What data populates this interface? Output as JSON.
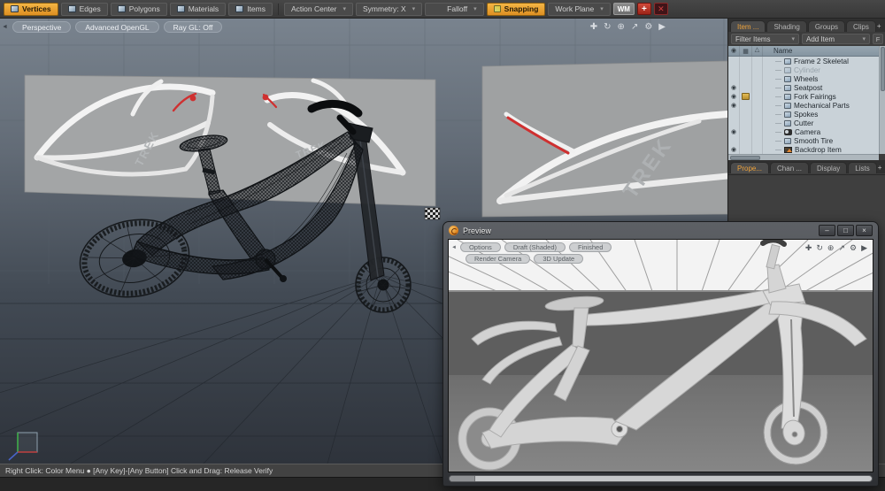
{
  "toolbar": {
    "modes": [
      {
        "label": "Vertices"
      },
      {
        "label": "Edges"
      },
      {
        "label": "Polygons"
      },
      {
        "label": "Materials"
      },
      {
        "label": "Items"
      }
    ],
    "action_center": "Action Center",
    "symmetry": "Symmetry: X",
    "falloff": "Falloff",
    "snapping": "Snapping",
    "work_plane": "Work Plane",
    "wm": "WM",
    "add": "+"
  },
  "viewport": {
    "buttons": [
      "Perspective",
      "Advanced OpenGL",
      "Ray GL: Off"
    ]
  },
  "panel": {
    "tabs_upper": [
      "Item ...",
      "Shading",
      "Groups",
      "Clips"
    ],
    "filter": "Filter Items",
    "add_item": "Add Item",
    "f": "F",
    "name_col": "Name",
    "items": [
      {
        "name": "Frame 2 Skeletal"
      },
      {
        "name": "Cylinder"
      },
      {
        "name": "Wheels"
      },
      {
        "name": "Seatpost"
      },
      {
        "name": "Fork Fairings"
      },
      {
        "name": "Mechanical Parts"
      },
      {
        "name": "Spokes"
      },
      {
        "name": "Cutter"
      },
      {
        "name": "Camera"
      },
      {
        "name": "Smooth Tire"
      },
      {
        "name": "Backdrop Item"
      }
    ],
    "tabs_lower": [
      "Prope...",
      "Chan ...",
      "Display",
      "Lists"
    ]
  },
  "preview": {
    "title": "Preview",
    "row1": [
      "Options",
      "Draft (Shaded)",
      "Finished"
    ],
    "row2": [
      "Render Camera",
      "3D Update"
    ]
  },
  "scene": {
    "brand_text": "TREK",
    "accent_red": "#cf3030",
    "orange_accent": "#eda23c"
  },
  "status": {
    "text": "Right Click: Color Menu ● [Any Key]-[Any Button] Click and Drag: Release Verify"
  },
  "icons": {
    "dropdown": "▾",
    "pan": "✚",
    "orbit": "↻",
    "magnify": "⊕",
    "fit": "↗",
    "gear": "⚙",
    "more": "▶",
    "collapse": "◄",
    "plus": "+",
    "minimize": "–",
    "maximize": "□",
    "close": "×",
    "eye": "◉",
    "column_b": "▦",
    "column_c": "△",
    "red_tool": "✕"
  }
}
